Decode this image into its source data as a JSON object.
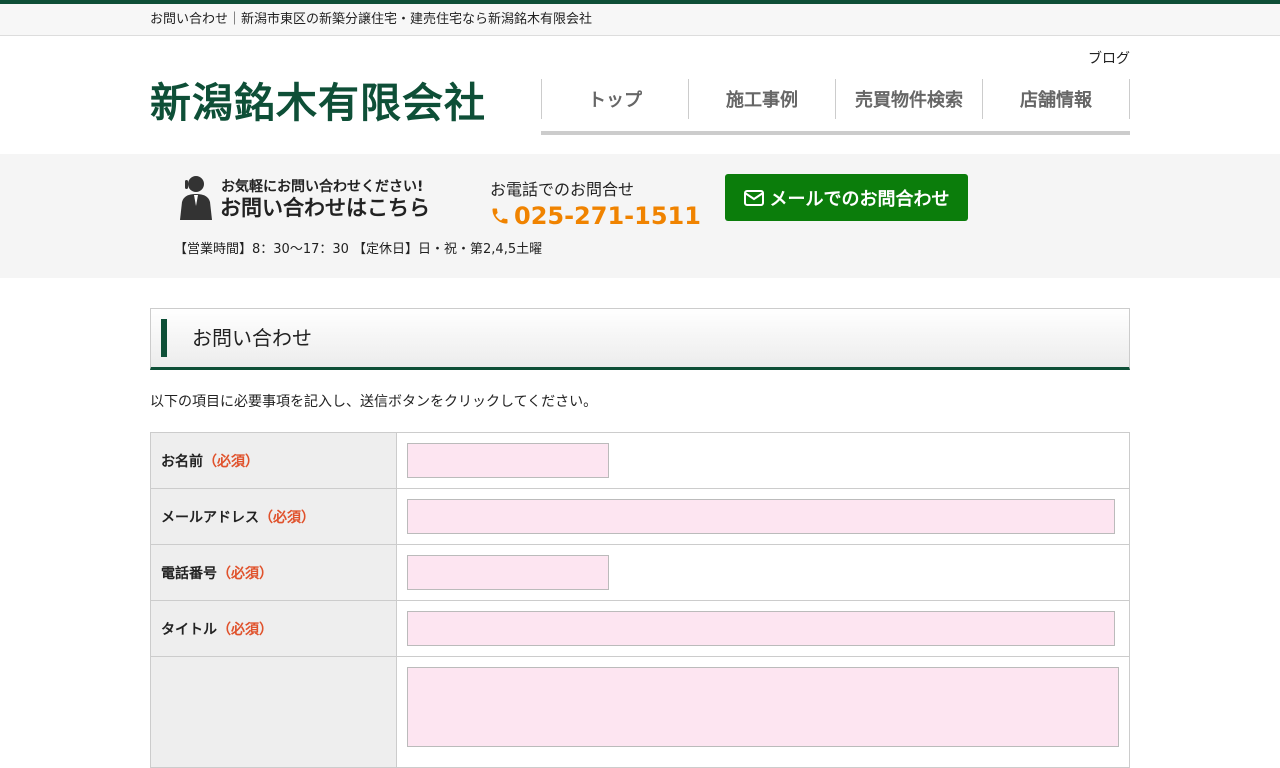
{
  "topbar": {
    "text": "お問い合わせ｜新潟市東区の新築分譲住宅・建売住宅なら新潟銘木有限会社"
  },
  "header": {
    "logo": "新潟銘木有限会社",
    "blog": "ブログ",
    "nav": [
      "トップ",
      "施工事例",
      "売買物件検索",
      "店舗情報"
    ]
  },
  "contact": {
    "lead": "お気軽にお問い合わせください!",
    "title": "お問い合わせはこちら",
    "tel_label": "お電話でのお問合せ",
    "tel": "025-271-1511",
    "mail_btn": "メールでのお問合わせ",
    "hours": "【営業時間】8：30～17：30 【定休日】日・祝・第2,4,5土曜"
  },
  "page": {
    "heading": "お問い合わせ",
    "intro": "以下の項目に必要事項を記入し、送信ボタンをクリックしてください。"
  },
  "form": {
    "required": "（必須）",
    "fields": [
      {
        "label": "お名前"
      },
      {
        "label": "メールアドレス"
      },
      {
        "label": "電話番号"
      },
      {
        "label": "タイトル"
      }
    ]
  },
  "colors": {
    "brand": "#0e4f37",
    "accent": "#f08300",
    "button": "#0b7d0b",
    "required": "#e0522c",
    "input_bg": "#fde5f1"
  }
}
